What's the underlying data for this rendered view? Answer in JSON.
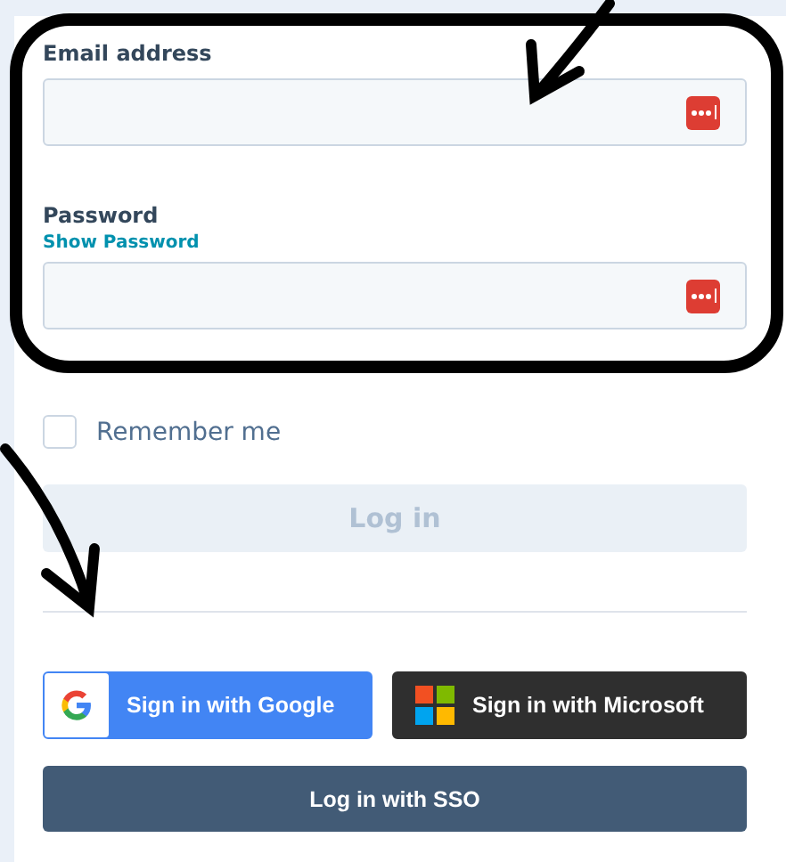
{
  "form": {
    "email": {
      "label": "Email address"
    },
    "password": {
      "label": "Password",
      "show_link": "Show Password"
    },
    "remember": {
      "label": "Remember me",
      "checked": false
    },
    "login": {
      "label": "Log in",
      "disabled": true
    },
    "social": [
      {
        "kind": "google",
        "label": "Sign in with Google"
      },
      {
        "kind": "microsoft",
        "label": "Sign in with Microsoft"
      }
    ],
    "sso": {
      "label": "Log in with SSO"
    }
  }
}
